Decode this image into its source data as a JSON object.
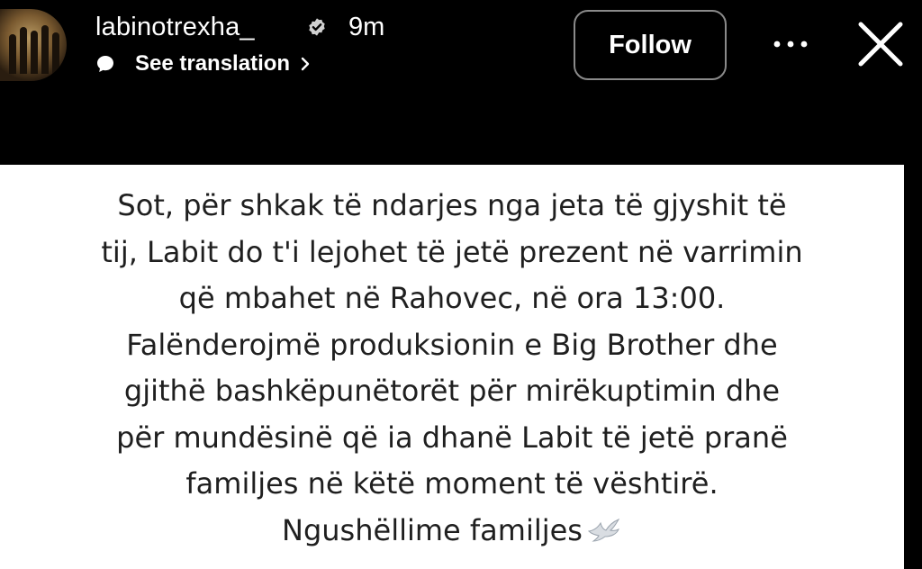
{
  "header": {
    "username": "labinotrexha_",
    "verified": true,
    "time_ago": "9m",
    "translation_label": "See translation",
    "follow_label": "Follow",
    "icons": {
      "avatar": "avatar",
      "verified": "verified-badge-icon",
      "translate": "translate-bubble-icon",
      "chevron": "chevron-right-icon",
      "more": "more-icon",
      "close": "close-icon"
    }
  },
  "story": {
    "lines": [
      "Sot, për shkak të ndarjes nga jeta të gjyshit të",
      "tij, Labit do t'i lejohet të jetë prezent në varrimin",
      "që mbahet në Rahovec, në ora 13:00.",
      "Falënderojmë produksionin e Big Brother dhe",
      "gjithë bashkëpunëtorët për mirëkuptimin dhe",
      "për mundësinë që ia dhanë Labit të jetë pranë",
      "familjes në këtë moment të vështirë.",
      "Ngushëllime familjes"
    ],
    "emoji": "dove-icon"
  },
  "colors": {
    "background": "#000000",
    "card": "#ffffff",
    "text": "#1f1f1f",
    "button_border": "#8a8a8a"
  }
}
